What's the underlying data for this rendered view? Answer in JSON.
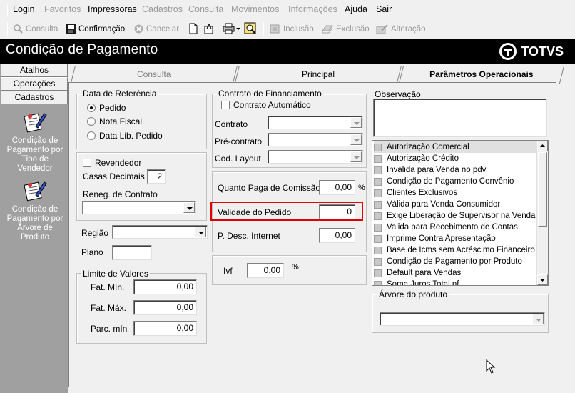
{
  "menu": {
    "login": "Login",
    "favoritos": "Favoritos",
    "impressoras": "Impressoras",
    "cadastros": "Cadastros",
    "consulta": "Consulta",
    "movimentos": "Movimentos",
    "informacoes": "Informações",
    "ajuda": "Ajuda",
    "sair": "Sair"
  },
  "toolbar": {
    "consulta": "Consulta",
    "confirmacao": "Confirmação",
    "cancelar": "Cancelar",
    "inclusao": "Inclusão",
    "exclusao": "Exclusão",
    "alteracao": "Alteração"
  },
  "window": {
    "title": "Condição de Pagamento",
    "brand": "TOTVS"
  },
  "sidebar": {
    "buttons": [
      "Atalhos",
      "Operações",
      "Cadastros"
    ],
    "items": [
      "Condição de Pagamento por Tipo de Vendedor",
      "Condição de Pagamento por Árvore de Produto"
    ]
  },
  "tabs": [
    "Consulta",
    "Principal",
    "Parâmetros Operacionais"
  ],
  "data_referencia": {
    "label": "Data de Referência",
    "options": [
      "Pedido",
      "Nota Fiscal",
      "Data Lib. Pedido"
    ],
    "selected": "Pedido"
  },
  "revendedor": {
    "label": "Revendedor",
    "casas_decimais_label": "Casas Decimais",
    "casas_decimais_value": "2",
    "reneg_label": "Reneg. de Contrato",
    "reneg_value": ""
  },
  "regiao": {
    "label": "Região",
    "value": ""
  },
  "plano": {
    "label": "Plano",
    "value": ""
  },
  "limite_valores": {
    "label": "Limite de Valores",
    "fat_min_label": "Fat. Mín.",
    "fat_min_value": "0,00",
    "fat_max_label": "Fat. Máx.",
    "fat_max_value": "0,00",
    "parc_min_label": "Parc. mín",
    "parc_min_value": "0,00"
  },
  "contrato": {
    "label": "Contrato de Financiamento",
    "automatico_label": "Contrato Automático",
    "contrato_label": "Contrato",
    "pre_contrato_label": "Pré-contrato",
    "cod_layout_label": "Cod. Layout"
  },
  "comissao": {
    "quanto_paga_label": "Quanto Paga de Comissão",
    "quanto_paga_value": "0,00",
    "quanto_paga_unit": "%",
    "validade_label": "Validade do Pedido",
    "validade_value": "0",
    "desc_internet_label": "P. Desc. Internet",
    "desc_internet_value": "0,00"
  },
  "ivf": {
    "label": "Ivf",
    "value": "0,00",
    "unit": "%"
  },
  "observacao": {
    "label": "Observação",
    "value": ""
  },
  "checklist": [
    "Autorização Comercial",
    "Autorização Crédito",
    "Inválida para Venda no pdv",
    "Condição de Pagamento Convênio",
    "Clientes Exclusivos",
    "Válida para Venda Consumidor",
    "Exige Liberação de Supervisor na Venda",
    "Valida para Recebimento de Contas",
    "Imprime Contra Apresentação",
    "Base de Icms sem Acréscimo Financeiro",
    "Condição de Pagamento por Produto",
    "Default para Vendas",
    "Soma Juros Total nf"
  ],
  "arvore": {
    "label": "Árvore do produto",
    "value": ""
  }
}
